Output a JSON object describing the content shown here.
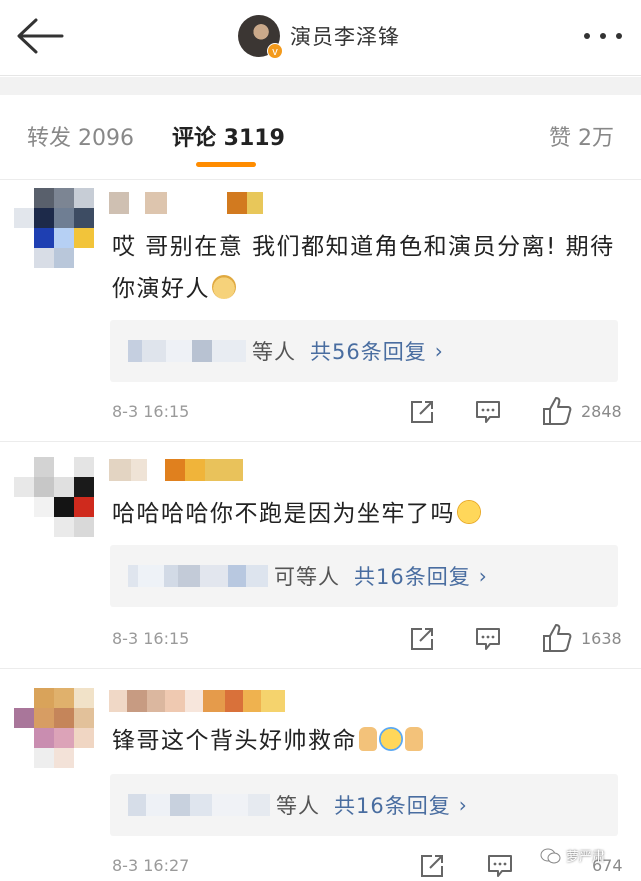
{
  "header": {
    "back_icon": "arrow-left-icon",
    "name": "演员李泽锋",
    "verified_badge": "v",
    "more_icon": "more-dots-icon"
  },
  "tabs": {
    "repost": "转发 2096",
    "comment": "评论 3119",
    "like": "赞 2万",
    "active_color": "#ff8c00"
  },
  "comments": [
    {
      "text": "哎 哥别在意 我们都知道角色和演员分离! 期待你演好人",
      "emoji": "doge-icon",
      "reply_who": "等人",
      "reply_count": "共56条回复",
      "reply_arrow": "›",
      "time": "8-3 16:15",
      "likes": "2848"
    },
    {
      "text": "哈哈哈哈你不跑是因为坐牢了吗",
      "emoji": "grin-icon",
      "reply_who": "可等人",
      "reply_count": "共16条回复",
      "reply_arrow": "›",
      "time": "8-3 16:15",
      "likes": "1638"
    },
    {
      "text": "锋哥这个背头好帅救命",
      "emoji": "thumb-cry-thumb-icons",
      "reply_who": "等人",
      "reply_count": "共16条回复",
      "reply_arrow": "›",
      "time": "8-3 16:27",
      "likes": "674"
    }
  ],
  "watermark": {
    "text": "萝严肃",
    "icon": "wechat-icon"
  },
  "colors": {
    "link": "#496da0",
    "meta": "#9a9a9a",
    "reply_bg": "#f4f4f4"
  }
}
